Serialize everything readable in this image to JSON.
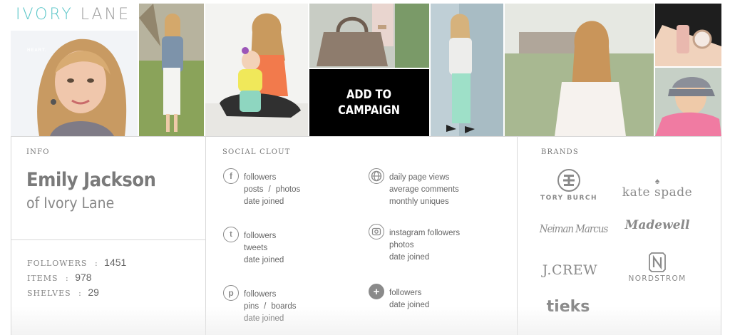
{
  "header": {
    "logo_part1": "IVORY",
    "logo_part2": "LANE",
    "heart_tag": "HEART.",
    "add_to_campaign": "ADD TO\nCAMPAIGN"
  },
  "info": {
    "section_label": "INFO",
    "name": "Emily Jackson",
    "blog": "of Ivory Lane",
    "stats": [
      {
        "label": "FOLLOWERS",
        "sep": ":",
        "value": "1451"
      },
      {
        "label": "ITEMS",
        "sep": ":",
        "value": "978"
      },
      {
        "label": "SHELVES",
        "sep": ":",
        "value": "29"
      }
    ]
  },
  "social": {
    "section_label": "SOCIAL CLOUT",
    "facebook": {
      "icon": "facebook-icon",
      "followers": "followers",
      "posts": "posts",
      "sep": "/",
      "photos": "photos",
      "date_joined": "date joined"
    },
    "twitter": {
      "icon": "twitter-icon",
      "followers": "followers",
      "tweets": "tweets",
      "date_joined": "date joined"
    },
    "pinterest": {
      "icon": "pinterest-icon",
      "followers": "followers",
      "pins": "pins",
      "sep": "/",
      "boards": "boards",
      "date_joined": "date joined"
    },
    "blog": {
      "icon": "globe-icon",
      "page_views": "daily page views",
      "comments": "average comments",
      "uniques": "monthly uniques"
    },
    "instagram": {
      "icon": "instagram-icon",
      "followers": "instagram followers",
      "photos": "photos",
      "date_joined": "date joined"
    },
    "googleplus": {
      "icon": "plus-icon",
      "followers": "followers",
      "date_joined": "date joined"
    }
  },
  "brands": {
    "section_label": "BRANDS",
    "items": [
      "TORY BURCH",
      "kate spade",
      "Neiman Marcus",
      "Madewell",
      "J.CREW",
      "NORDSTROM",
      "tieks"
    ]
  }
}
